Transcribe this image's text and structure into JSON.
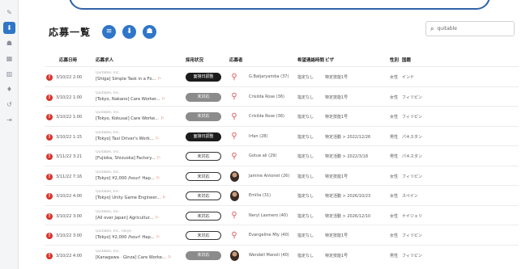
{
  "sidebar": {
    "items": [
      {
        "icon": "pencil-icon",
        "glyph": "✎",
        "active": false
      },
      {
        "icon": "person-icon",
        "glyph": "⬇",
        "active": true
      },
      {
        "icon": "people-icon",
        "glyph": "☗",
        "active": false
      },
      {
        "icon": "grid-icon",
        "glyph": "▦",
        "active": false
      },
      {
        "icon": "building-icon",
        "glyph": "▥",
        "active": false
      },
      {
        "icon": "pin-icon",
        "glyph": "♦",
        "active": false
      },
      {
        "icon": "cycle-icon",
        "glyph": "↺",
        "active": false
      },
      {
        "icon": "logout-icon",
        "glyph": "⇥",
        "active": false
      }
    ]
  },
  "header": {
    "title": "応募一覧",
    "buttons": [
      "filter-icon",
      "download-icon",
      "user-add-icon"
    ]
  },
  "search": {
    "icon": "search-icon",
    "value": "quitable"
  },
  "table": {
    "headers": [
      "応募日時",
      "応募求人",
      "採用状況",
      "応募者",
      "希望連絡時間",
      "ビザ",
      "性別",
      "国籍"
    ],
    "rows": [
      {
        "date": "3/10/22 2:00",
        "company": "Quitable, Inc.",
        "title": "[Shiga] Simple Task in a Fo...",
        "status": "面接日調整",
        "status_style": "dark",
        "avatar": "outline",
        "name": "G.Batjaryamba (37)",
        "contact": "指定なし",
        "visa": "特定技能1号",
        "gender": "女性",
        "nation": "インド"
      },
      {
        "date": "3/10/22 1:00",
        "company": "Quitable, Inc.",
        "title": "[Tokyo, Nakano] Care Worker...",
        "status": "未対応",
        "status_style": "gray",
        "avatar": "outline",
        "name": "Crisilda Rose (36)",
        "contact": "指定なし",
        "visa": "特定技能1号",
        "gender": "女性",
        "nation": "フィリピン"
      },
      {
        "date": "3/10/22 1:00",
        "company": "Quitable, Inc.",
        "title": "[Tokyo, Kokusai] Care Worke...",
        "status": "未対応",
        "status_style": "gray",
        "avatar": "outline",
        "name": "Crisilda Rose (36)",
        "contact": "指定なし",
        "visa": "特定技能1号",
        "gender": "女性",
        "nation": "フィリピン"
      },
      {
        "date": "3/10/22 1:15",
        "company": "Quitable, Inc.",
        "title": "[Tokyo] Taxi Driver's Work...",
        "status": "面接日調整",
        "status_style": "dark",
        "avatar": "outline",
        "name": "Irfan (28)",
        "contact": "指定なし",
        "visa": "特定活動 > 2022/12/26",
        "gender": "男性",
        "nation": "パキスタン"
      },
      {
        "date": "3/11/22 3:21",
        "company": "Quitable, Inc.",
        "title": "[Fujioka, Shizuoka] Factory...",
        "status": "未対応",
        "status_style": "outline",
        "avatar": "outline",
        "name": "Gotue ali (29)",
        "contact": "指定なし",
        "visa": "特定活動 > 2022/3/18",
        "gender": "男性",
        "nation": "パキスタン"
      },
      {
        "date": "3/11/22 7:16",
        "company": "Quitable, Inc.",
        "title": "[Tokyo] ¥2,000 /hour! Hap...",
        "status": "未対応",
        "status_style": "outline",
        "avatar": "photo",
        "name": "Jamine Antonet (26)",
        "contact": "指定なし",
        "visa": "特定技能1号",
        "gender": "女性",
        "nation": "フィリピン"
      },
      {
        "date": "3/10/22 4:00",
        "company": "Quitable, Inc.",
        "title": "[Tokyo] Unity Game Engineer...",
        "status": "未対応",
        "status_style": "outline",
        "avatar": "photo",
        "name": "Emilia (31)",
        "contact": "指定なし",
        "visa": "特定活動 > 2026/10/23",
        "gender": "女性",
        "nation": "スペイン"
      },
      {
        "date": "3/10/22 3:00",
        "company": "Quitable, Inc.",
        "title": "[All over Japan] Agricultur...",
        "status": "未対応",
        "status_style": "outline",
        "avatar": "outline",
        "name": "Neryl Lasmero (40)",
        "contact": "指定なし",
        "visa": "特定活動 > 2026/12/10",
        "gender": "女性",
        "nation": "ナイジェリ"
      },
      {
        "date": "3/10/22 3:00",
        "company": "Quitable, Inc. Tokyo",
        "title": "[Tokyo] ¥2,000 /hour! Hap...",
        "status": "未対応",
        "status_style": "outline",
        "avatar": "outline",
        "name": "Evangeline Mly (40)",
        "contact": "指定なし",
        "visa": "特定技能1号",
        "gender": "女性",
        "nation": "フィリピン"
      },
      {
        "date": "3/10/22 4:00",
        "company": "Quitable, Inc.",
        "title": "[Kanagawa · Ginza] Care Worke...",
        "status": "未対応",
        "status_style": "gray",
        "avatar": "photo",
        "name": "Wendell Manoli (40)",
        "contact": "指定なし",
        "visa": "特定技能1号",
        "gender": "男性",
        "nation": "フィリピン"
      }
    ]
  }
}
